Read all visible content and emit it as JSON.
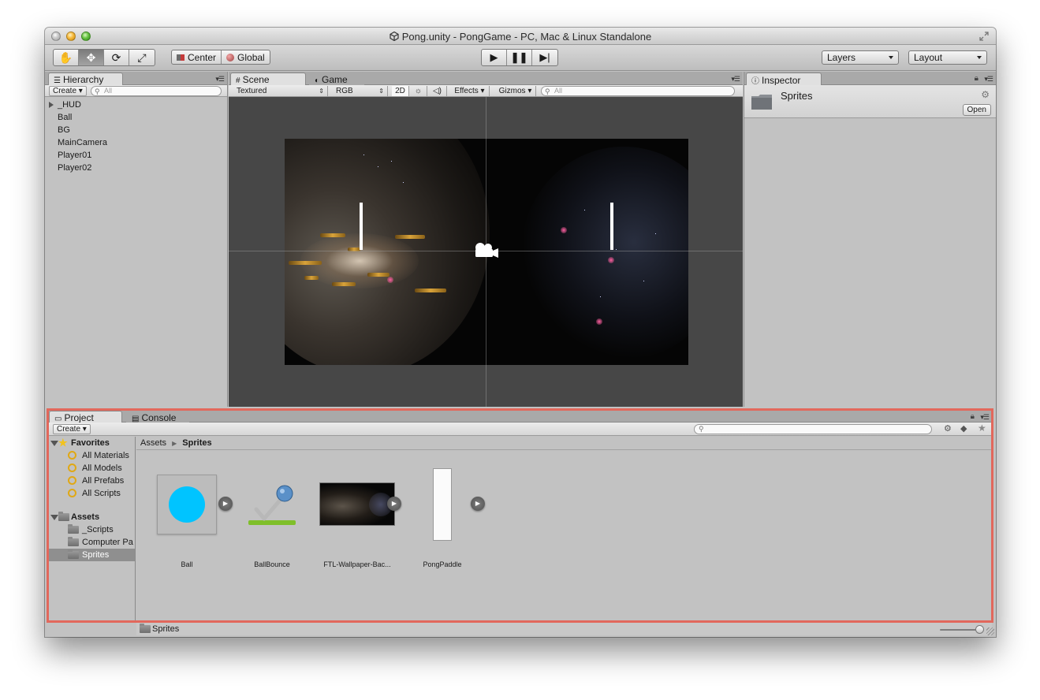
{
  "window": {
    "title": "Pong.unity - PongGame - PC, Mac & Linux Standalone"
  },
  "toolbar": {
    "tools": [
      "hand-icon",
      "move-icon",
      "rotate-icon",
      "scale-icon"
    ],
    "pivot_center": "Center",
    "pivot_global": "Global",
    "playback": [
      "play-icon",
      "pause-icon",
      "step-icon"
    ],
    "layers": "Layers",
    "layout": "Layout"
  },
  "hierarchy": {
    "tab": "Hierarchy",
    "create": "Create",
    "search_placeholder": "All",
    "items": [
      "_HUD",
      "Ball",
      "BG",
      "MainCamera",
      "Player01",
      "Player02"
    ]
  },
  "scene": {
    "tab_scene": "Scene",
    "tab_game": "Game",
    "render_mode": "Textured",
    "color_mode": "RGB",
    "mode_2d": "2D",
    "effects": "Effects",
    "gizmos": "Gizmos",
    "search_placeholder": "All"
  },
  "inspector": {
    "tab": "Inspector",
    "title": "Sprites",
    "open_button": "Open"
  },
  "project": {
    "tab_project": "Project",
    "tab_console": "Console",
    "create": "Create",
    "favorites_label": "Favorites",
    "favorites": [
      "All Materials",
      "All Models",
      "All Prefabs",
      "All Scripts"
    ],
    "assets_label": "Assets",
    "folders": [
      "_Scripts",
      "Computer Pa",
      "Sprites"
    ],
    "breadcrumb_root": "Assets",
    "breadcrumb_current": "Sprites",
    "assets": [
      "Ball",
      "BallBounce",
      "FTL-Wallpaper-Bac...",
      "PongPaddle"
    ],
    "status_path": "Sprites",
    "zoom_level": 1.0
  },
  "colors": {
    "highlight_outline": "#e2685c",
    "ball_color": "#00c4ff",
    "bounce_bar": "#7fbf2a"
  }
}
